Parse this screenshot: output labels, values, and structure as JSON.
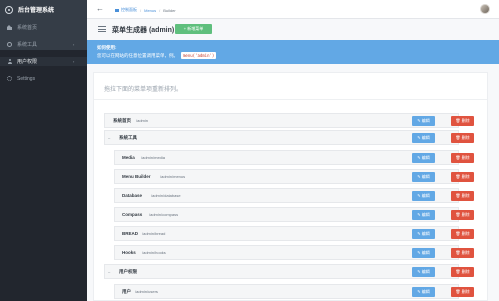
{
  "sidebar": {
    "brand": "后台管理系统",
    "items": [
      {
        "label": "系统首页",
        "icon": "home-icon"
      },
      {
        "label": "系统工具",
        "icon": "tools-icon",
        "caret": "‹"
      },
      {
        "label": "用户权限",
        "icon": "user-icon",
        "caret": "‹"
      },
      {
        "label": "Settings",
        "icon": "gear-icon"
      }
    ]
  },
  "topbar": {
    "back": "←",
    "breadcrumbs": [
      "控制面板",
      "Menus",
      "Builder"
    ],
    "separator": "/"
  },
  "header": {
    "title": "菜单生成器 (admin)",
    "add_button": "+ 新增菜单"
  },
  "alert": {
    "title": "如何使用:",
    "text": "您可以在网站的任意位置调用菜单，例。",
    "code": "menu('admin')"
  },
  "panel": {
    "hint": "拖拉下面的菜单项重新排列。",
    "edit_label": "✎ 编辑",
    "delete_label": "🗑 删除",
    "rows": [
      {
        "title": "系统首页",
        "url": "/admin"
      },
      {
        "title": "系统工具",
        "url": ""
      },
      {
        "title": "Media",
        "url": "/admin/media"
      },
      {
        "title": "Menu Builder",
        "url": "/admin/menus"
      },
      {
        "title": "Database",
        "url": "/admin/database"
      },
      {
        "title": "Compass",
        "url": "/admin/compass"
      },
      {
        "title": "BREAD",
        "url": "/admin/bread"
      },
      {
        "title": "Hooks",
        "url": "/admin/hooks"
      },
      {
        "title": "用户权限",
        "url": ""
      },
      {
        "title": "用户",
        "url": "/admin/users"
      }
    ],
    "toggle": "–"
  },
  "colors": {
    "sidebar": "#22262e",
    "alert": "#62a8e5",
    "add": "#5fbf7d",
    "edit": "#62a8e5",
    "delete": "#e0533f"
  }
}
